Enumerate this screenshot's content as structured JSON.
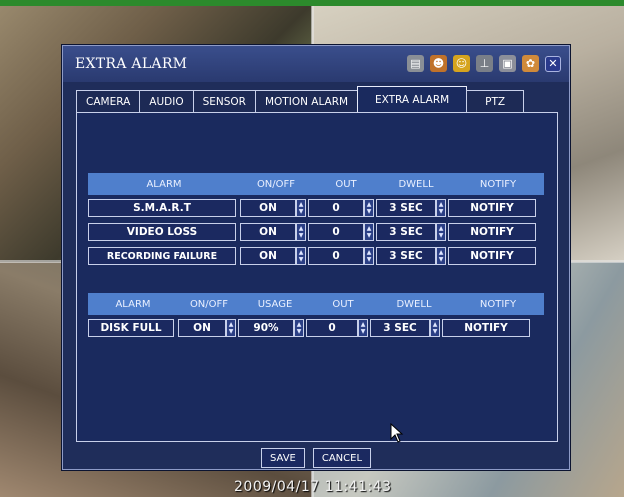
{
  "window": {
    "title": "EXTRA ALARM"
  },
  "title_icons": [
    "hdd-icon",
    "person-icon",
    "face-icon",
    "antenna-icon",
    "monitor-icon",
    "settings-icon"
  ],
  "tabs": [
    {
      "label": "CAMERA"
    },
    {
      "label": "AUDIO"
    },
    {
      "label": "SENSOR"
    },
    {
      "label": "MOTION ALARM"
    },
    {
      "label": "EXTRA ALARM",
      "active": true
    },
    {
      "label": "PTZ"
    }
  ],
  "table1": {
    "headers": [
      "ALARM",
      "ON/OFF",
      "OUT",
      "DWELL",
      "NOTIFY"
    ],
    "rows": [
      {
        "alarm": "S.M.A.R.T",
        "onoff": "ON",
        "out": "0",
        "dwell": "3 SEC",
        "notify": "NOTIFY"
      },
      {
        "alarm": "VIDEO LOSS",
        "onoff": "ON",
        "out": "0",
        "dwell": "3 SEC",
        "notify": "NOTIFY"
      },
      {
        "alarm": "RECORDING FAILURE",
        "onoff": "ON",
        "out": "0",
        "dwell": "3 SEC",
        "notify": "NOTIFY"
      }
    ]
  },
  "table2": {
    "headers": [
      "ALARM",
      "ON/OFF",
      "USAGE",
      "OUT",
      "DWELL",
      "NOTIFY"
    ],
    "rows": [
      {
        "alarm": "DISK FULL",
        "onoff": "ON",
        "usage": "90%",
        "out": "0",
        "dwell": "3 SEC",
        "notify": "NOTIFY"
      }
    ]
  },
  "buttons": {
    "save": "SAVE",
    "cancel": "CANCEL"
  },
  "timestamp": "2009/04/17 11:41:43",
  "colors": {
    "dialog_bg": "#1f2d5a",
    "header_bg": "#4f7fcc",
    "accent_green": "#2c8a2c"
  }
}
